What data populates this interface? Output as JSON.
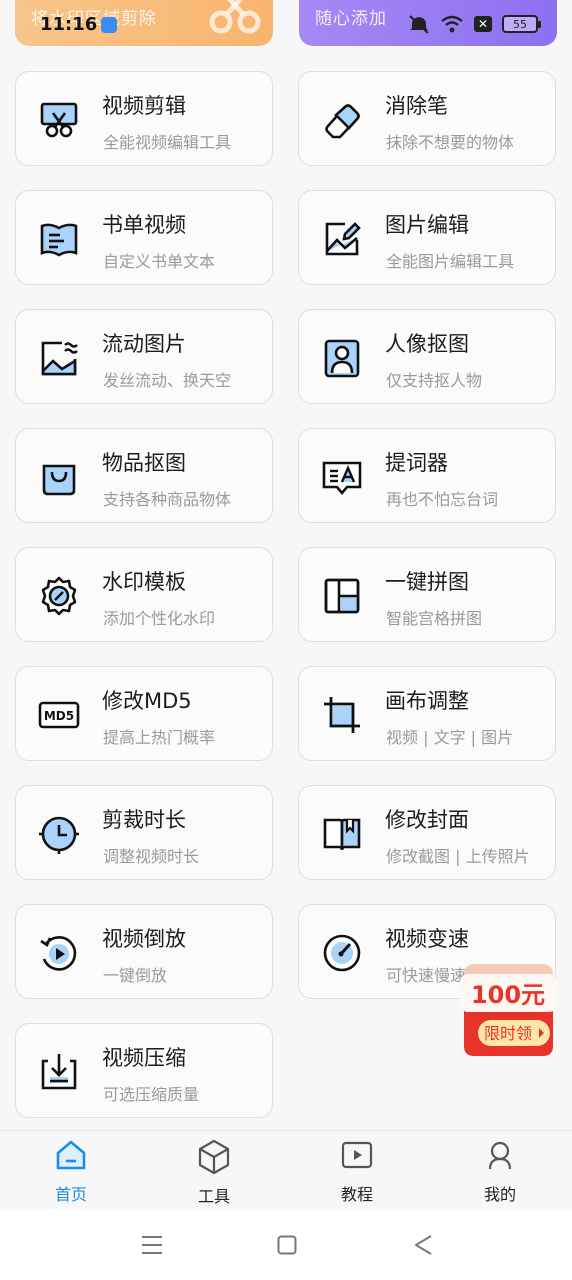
{
  "status_bar": {
    "time": "11:16",
    "battery": "55"
  },
  "banners": {
    "left_text": "将水印区域剪除",
    "right_text": "随心添加"
  },
  "tools": [
    {
      "title": "视频剪辑",
      "subtitle": "全能视频编辑工具"
    },
    {
      "title": "消除笔",
      "subtitle": "抹除不想要的物体"
    },
    {
      "title": "书单视频",
      "subtitle": "自定义书单文本"
    },
    {
      "title": "图片编辑",
      "subtitle": "全能图片编辑工具"
    },
    {
      "title": "流动图片",
      "subtitle": "发丝流动、换天空"
    },
    {
      "title": "人像抠图",
      "subtitle": "仅支持抠人物"
    },
    {
      "title": "物品抠图",
      "subtitle": "支持各种商品物体"
    },
    {
      "title": "提词器",
      "subtitle": "再也不怕忘台词"
    },
    {
      "title": "水印模板",
      "subtitle": "添加个性化水印"
    },
    {
      "title": "一键拼图",
      "subtitle": "智能宫格拼图"
    },
    {
      "title": "修改MD5",
      "subtitle": "提高上热门概率"
    },
    {
      "title": "画布调整",
      "subtitle": "视频 | 文字 | 图片"
    },
    {
      "title": "剪裁时长",
      "subtitle": "调整视频时长"
    },
    {
      "title": "修改封面",
      "subtitle": "修改截图 | 上传照片"
    },
    {
      "title": "视频倒放",
      "subtitle": "一键倒放"
    },
    {
      "title": "视频变速",
      "subtitle": "可快速慢速变"
    },
    {
      "title": "视频压缩",
      "subtitle": "可选压缩质量"
    }
  ],
  "icons": {
    "md5_label": "MD5",
    "teleprompter_label": "≡A"
  },
  "promo": {
    "amount": "100元",
    "label": "限时领"
  },
  "bottom_nav": [
    {
      "label": "首页",
      "icon": "home-icon",
      "active": true
    },
    {
      "label": "工具",
      "icon": "cube-icon",
      "active": false
    },
    {
      "label": "教程",
      "icon": "play-tutorial-icon",
      "active": false
    },
    {
      "label": "我的",
      "icon": "person-icon",
      "active": false
    }
  ],
  "colors": {
    "accent": "#1e8be8",
    "icon_fill": "#a9d3fb",
    "promo_red": "#e8322c"
  }
}
